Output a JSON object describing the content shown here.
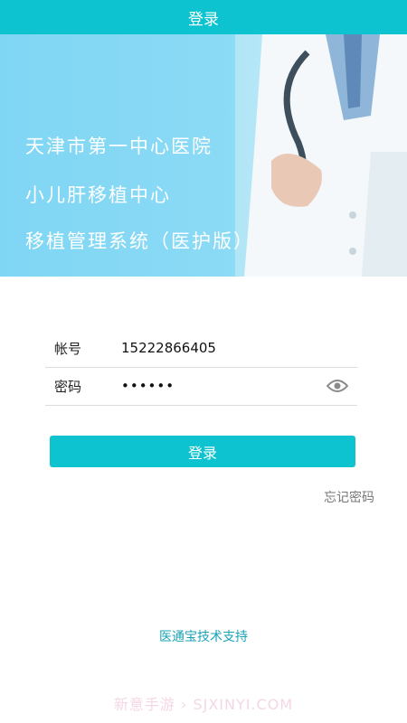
{
  "header": {
    "title": "登录"
  },
  "banner": {
    "line1": "天津市第一中心医院",
    "line2": "小儿肝移植中心",
    "line3": "移植管理系统（医护版）"
  },
  "form": {
    "account_label": "帐号",
    "account_value": "15222866405",
    "password_label": "密码",
    "password_value": "••••••"
  },
  "actions": {
    "login_label": "登录",
    "forgot_label": "忘记密码"
  },
  "footer": {
    "support": "医通宝技术支持",
    "watermark": "新意手游 › SJXINYI.COM"
  },
  "colors": {
    "accent": "#0dc3cf",
    "banner": "#8bdaf5",
    "support_text": "#18a3b5"
  },
  "icons": {
    "password_toggle": "eye-icon"
  }
}
